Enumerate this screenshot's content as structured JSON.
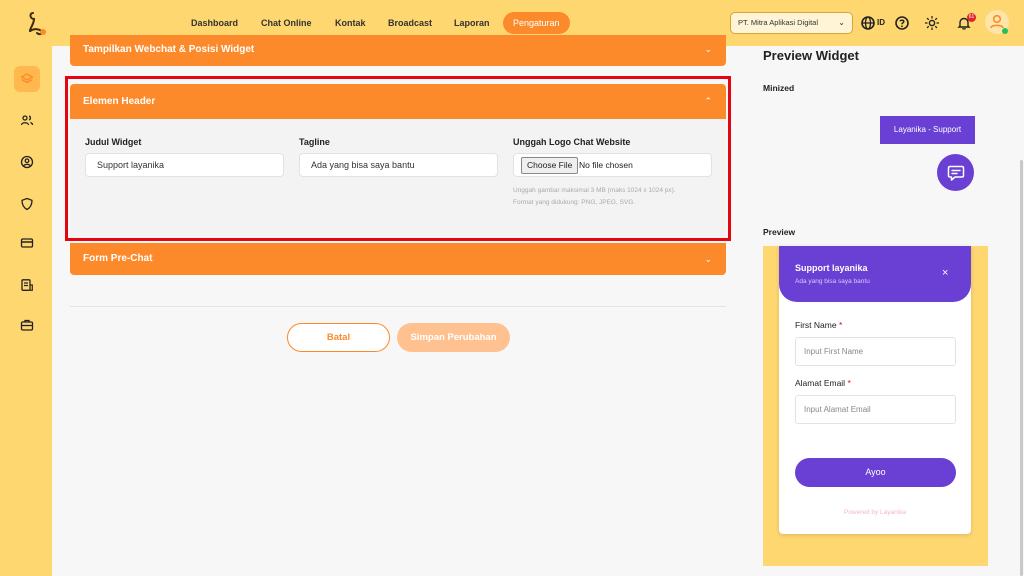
{
  "nav": {
    "items": [
      {
        "label": "Dashboard",
        "active": false
      },
      {
        "label": "Chat Online",
        "active": false
      },
      {
        "label": "Kontak",
        "active": false
      },
      {
        "label": "Broadcast",
        "active": false
      },
      {
        "label": "Laporan",
        "active": false
      },
      {
        "label": "Pengaturan",
        "active": true
      }
    ]
  },
  "topbar": {
    "company": "PT. Mitra Aplikasi Digital",
    "language": "ID",
    "notification_count": "61",
    "icons": [
      "globe-icon",
      "help-icon",
      "theme-icon",
      "bell-icon",
      "user-icon"
    ]
  },
  "sidebar": {
    "items": [
      {
        "icon": "layers-icon",
        "active": true
      },
      {
        "icon": "users-icon",
        "active": false
      },
      {
        "icon": "user-circle-icon",
        "active": false
      },
      {
        "icon": "shield-icon",
        "active": false
      },
      {
        "icon": "card-icon",
        "active": false
      },
      {
        "icon": "document-icon",
        "active": false
      },
      {
        "icon": "briefcase-icon",
        "active": false
      }
    ]
  },
  "main": {
    "section_top": "Tampilkan Webchat & Posisi Widget",
    "section_header": "Elemen Header",
    "section_form": "Form Pre-Chat",
    "fields": {
      "title_label": "Judul Widget",
      "title_value": "Support layanika",
      "tagline_label": "Tagline",
      "tagline_value": "Ada yang bisa saya bantu",
      "logo_label": "Unggah Logo Chat Website",
      "file_button": "Choose File",
      "file_status": "No file chosen",
      "hint_line1": "Unggah gambar maksimal 3 MB (maks 1024 x 1024 px).",
      "hint_line2": "Format yang didukung: PNG, JPEG, SVG."
    },
    "buttons": {
      "cancel": "Batal",
      "save": "Simpan Perubahan"
    }
  },
  "preview": {
    "title": "Preview Widget",
    "minized_label": "Minized",
    "bubble_text": "Layanika - Support",
    "preview_label": "Preview",
    "widget": {
      "title": "Support layanika",
      "tagline": "Ada yang bisa saya bantu",
      "close": "×",
      "first_name_label": "First Name",
      "first_name_placeholder": "Input First Name",
      "email_label": "Alamat Email",
      "email_placeholder": "Input Alamat Email",
      "required_mark": "*",
      "submit": "Ayoo",
      "powered": "Powered by Layanika"
    }
  },
  "colors": {
    "brand_yellow": "#ffd770",
    "brand_orange": "#fd8a2a",
    "widget_purple": "#6a3fd4",
    "highlight_red": "#e3050f"
  }
}
